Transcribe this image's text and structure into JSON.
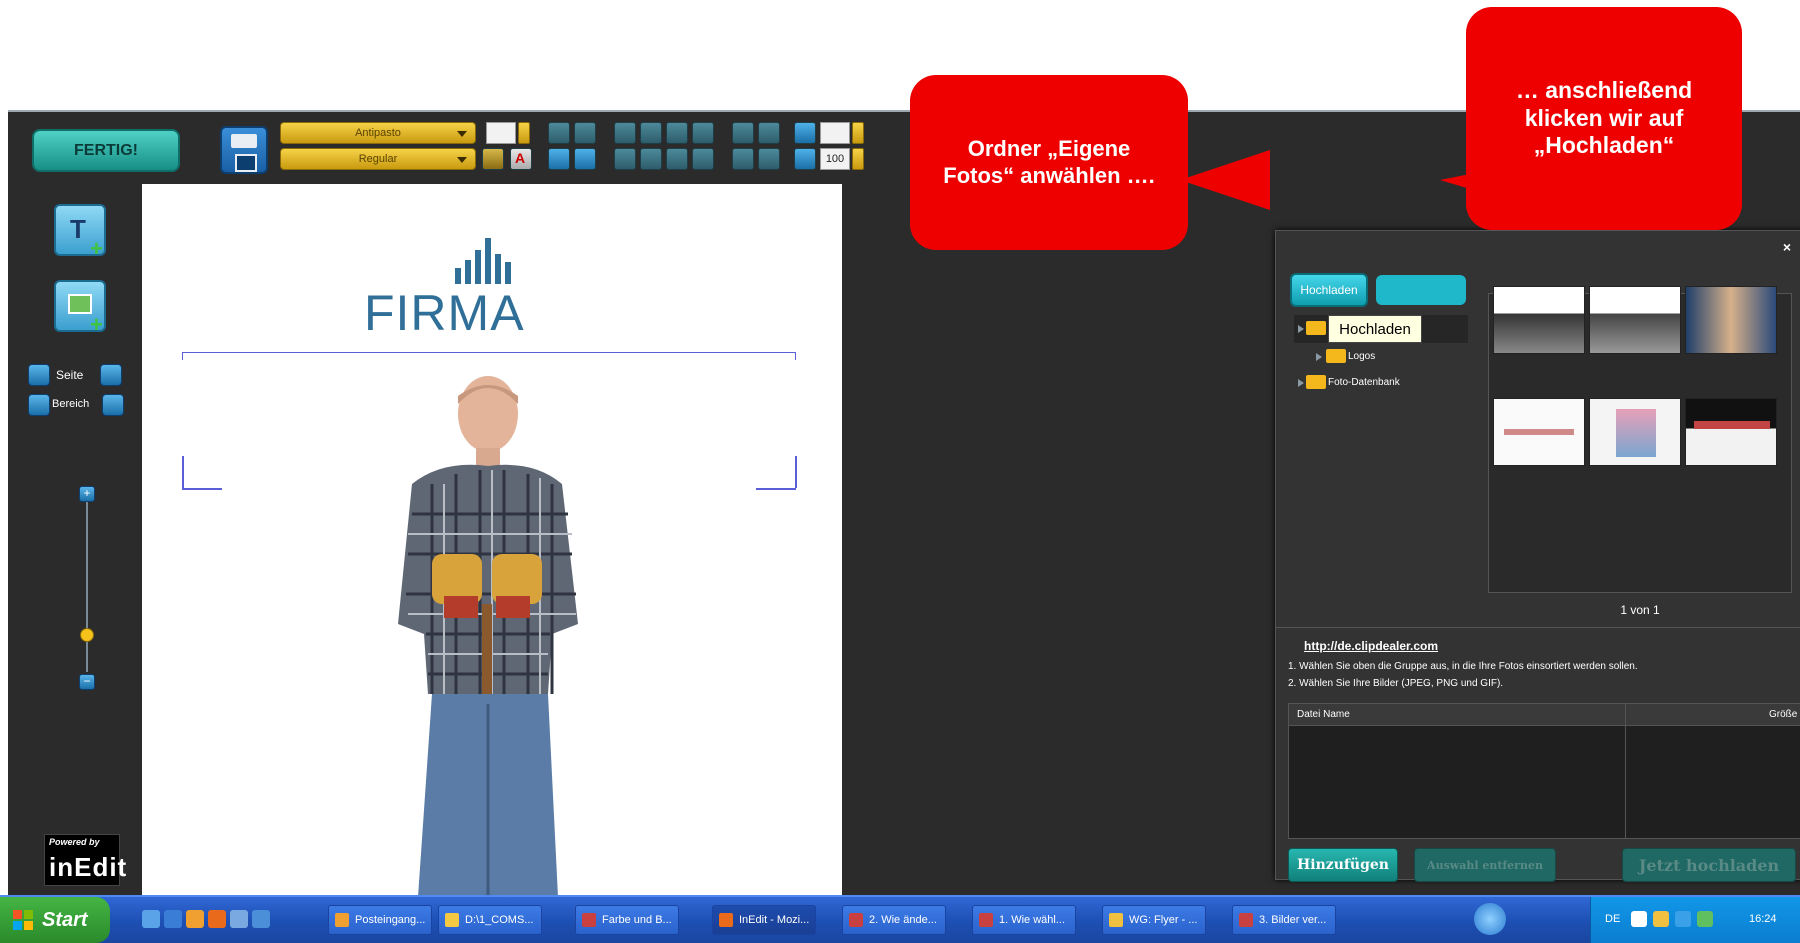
{
  "toolbar": {
    "finish_label": "FERTIG!",
    "font_name": "Antipasto",
    "font_style": "Regular",
    "zoom_value": "100"
  },
  "left_tools": {
    "page_label": "Seite",
    "area_label": "Bereich",
    "powered_small": "Powered by",
    "powered_big": "inEdit"
  },
  "canvas": {
    "logo_text": "FIRMA"
  },
  "panel": {
    "upload_button": "Hochladen",
    "tooltip": "Hochladen",
    "tree": [
      {
        "label": "Logos"
      },
      {
        "label": "Foto-Datenbank"
      }
    ],
    "pager": "1 von 1",
    "link": "http://de.clipdealer.com",
    "instructions": [
      "1. Wählen Sie oben die Gruppe aus, in die Ihre Fotos einsortiert werden sollen.",
      "2. Wählen Sie Ihre Bilder (JPEG, PNG und GIF)."
    ],
    "table_headers": [
      "Datei Name",
      "Größe"
    ],
    "add_button": "Hinzufügen",
    "remove_button": "Auswahl entfernen",
    "upload_now_button": "Jetzt hochladen"
  },
  "callouts": {
    "left": "Ordner „Eigene Fotos“ anwählen ….",
    "right": "… anschließend klicken wir auf „Hochladen“"
  },
  "taskbar": {
    "start_label": "Start",
    "tasks": [
      {
        "label": "Posteingang...",
        "active": false
      },
      {
        "label": "D:\\1_COMS...",
        "active": false
      },
      {
        "label": "Farbe und B...",
        "active": false
      },
      {
        "label": "InEdit - Mozi...",
        "active": true
      },
      {
        "label": "2. Wie ände...",
        "active": false
      },
      {
        "label": "1. Wie wähl...",
        "active": false
      },
      {
        "label": "WG: Flyer - ...",
        "active": false
      },
      {
        "label": "3. Bilder ver...",
        "active": false
      }
    ],
    "tray_lang": "DE",
    "clock": "16:24"
  },
  "colors": {
    "app_bg": "#2b2b2b",
    "accent_teal": "#1fb8ca",
    "callout_red": "#ee0000",
    "logo_blue": "#2f6f98"
  }
}
